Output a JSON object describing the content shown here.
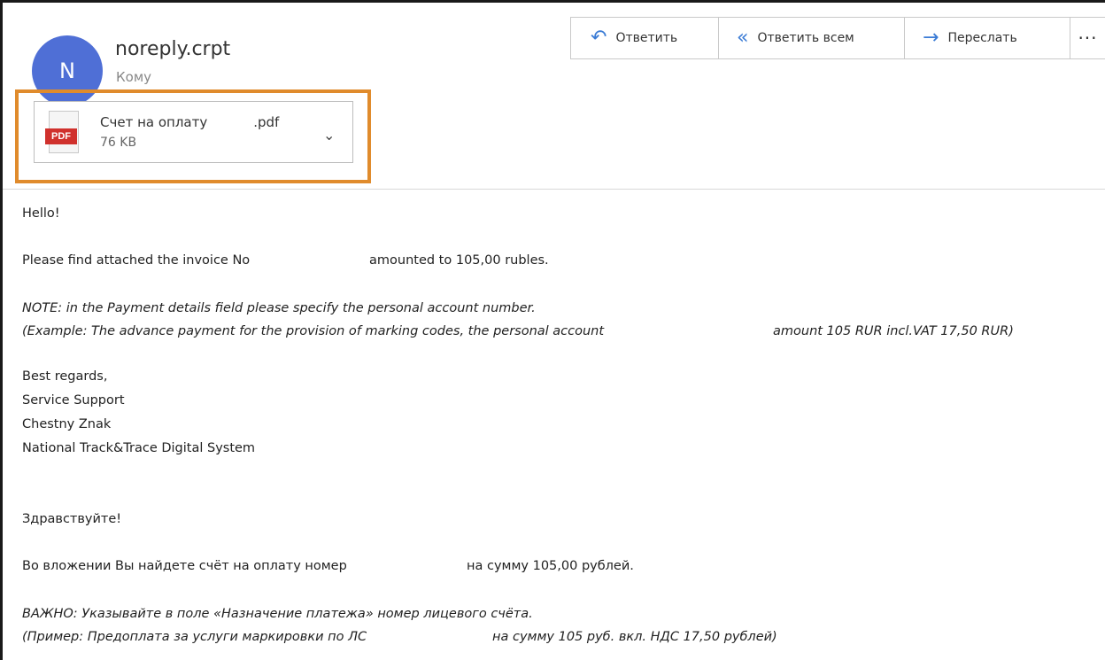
{
  "header": {
    "avatar_initial": "N",
    "sender": "noreply.crpt",
    "recipient_label": "Кому"
  },
  "toolbar": {
    "reply": "Ответить",
    "reply_all": "Ответить всем",
    "forward": "Переслать",
    "more": "···"
  },
  "attachment": {
    "badge": "PDF",
    "name": "Счет на оплату",
    "extension": ".pdf",
    "size": "76 KB"
  },
  "message": {
    "greeting_en": "Hello!",
    "invoice_en_part1": "Please find attached the invoice No",
    "invoice_en_part2": "amounted to 105,00 rubles.",
    "note_en": "NOTE: in the Payment details field please specify the personal account number.",
    "example_en_part1": "(Example: The advance payment for the provision of marking codes, the personal account",
    "example_en_part2": "amount 105 RUR incl.VAT 17,50 RUR)",
    "regards": "Best regards,",
    "sig_line1": "Service Support",
    "sig_line2": "Chestny Znak",
    "sig_line3": "National Track&Trace Digital System",
    "greeting_ru": "Здравствуйте!",
    "invoice_ru_part1": "Во вложении Вы найдете счёт на оплату номер",
    "invoice_ru_part2": "на сумму 105,00 рублей.",
    "note_ru": "ВАЖНО: Указывайте в поле «Назначение платежа» номер лицевого счёта.",
    "example_ru_part1": "(Пример: Предоплата за услуги маркировки по ЛС",
    "example_ru_part2": "на сумму 105 руб. вкл. НДС 17,50 рублей)"
  },
  "colors": {
    "avatar": "#4f6fd6",
    "highlight": "#e08b2c",
    "icon_accent": "#3a7bd5",
    "pdf_badge": "#d0312d"
  }
}
